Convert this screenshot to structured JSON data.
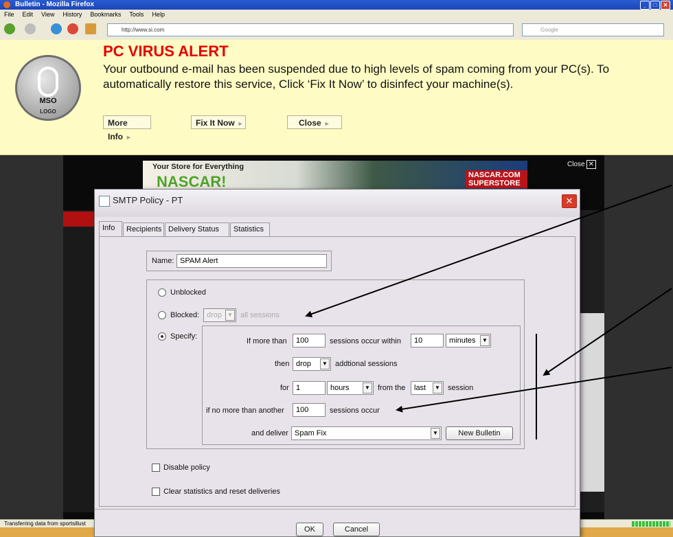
{
  "browser": {
    "title": "Bulletin - Mozilla Firefox",
    "menu": [
      "File",
      "Edit",
      "View",
      "History",
      "Bookmarks",
      "Tools",
      "Help"
    ],
    "url": "http://www.si.com",
    "search_placeholder": "Google",
    "status_text": "Transferring data from sportsillust"
  },
  "alert": {
    "logo_text": "MSO",
    "logo_subtext": "LOGO",
    "title": "PC VIRUS ALERT",
    "message": "Your outbound e-mail has been suspended due to high levels of spam coming from your PC(s).  To automatically restore this service, Click ‘Fix It Now’ to disinfect your machine(s).",
    "buttons": {
      "more_info": "More Info",
      "fix_it_now": "Fix It Now",
      "close": "Close"
    }
  },
  "webpage": {
    "ad_line1": "Your Store for Everything",
    "ad_line2": "NASCAR!",
    "ad_badge": "NASCAR.COM SUPERSTORE",
    "close_label": "Close"
  },
  "dialog": {
    "title": "SMTP Policy - PT",
    "tabs": [
      "Info",
      "Recipients",
      "Delivery Status",
      "Statistics"
    ],
    "name_label": "Name:",
    "name_value": "SPAM Alert",
    "options": {
      "unblocked": "Unblocked",
      "blocked": "Blocked:",
      "blocked_action": "drop",
      "blocked_suffix": "all sessions",
      "specify": "Specify:"
    },
    "specify": {
      "if_more_than": "If more than",
      "sessions_count": "100",
      "sessions_occur_within": "sessions occur within",
      "within_value": "10",
      "within_unit": "minutes",
      "then": "then",
      "then_action": "drop",
      "additional_sessions": "addtional sessions",
      "for": "for",
      "for_value": "1",
      "for_unit": "hours",
      "from_the": "from the",
      "from_which": "last",
      "session": "session",
      "if_no_more": "if no more than another",
      "no_more_value": "100",
      "sessions_occur": "sessions occur",
      "and_deliver": "and deliver",
      "deliver_value": "Spam Fix",
      "new_bulletin": "New Bulletin"
    },
    "disable_policy": "Disable policy",
    "clear_stats": "Clear statistics and reset deliveries",
    "ok": "OK",
    "cancel": "Cancel"
  }
}
